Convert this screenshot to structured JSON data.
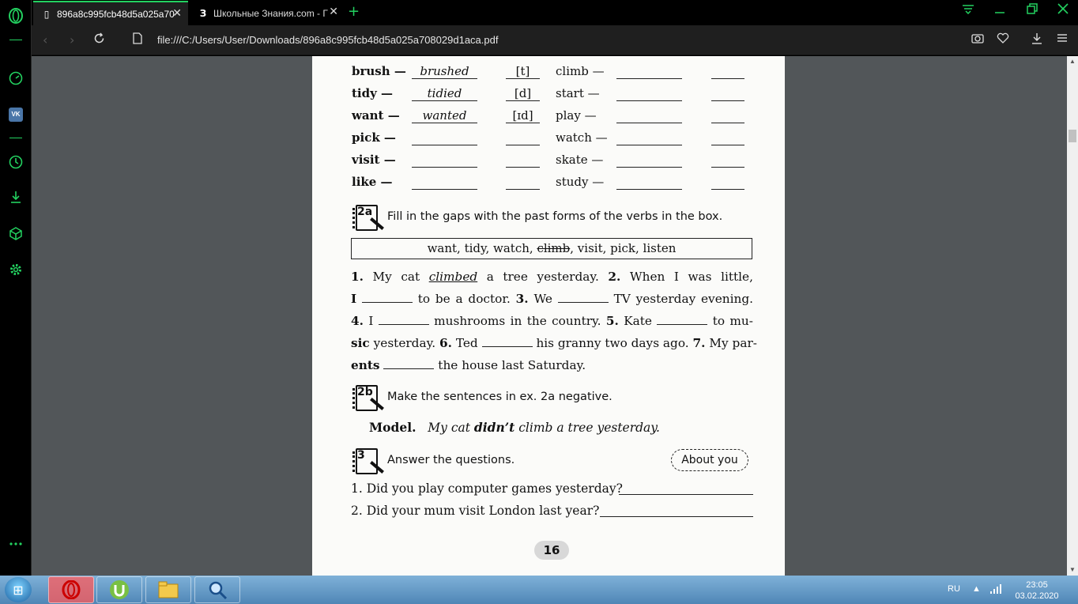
{
  "browser": {
    "tabs": [
      {
        "title": "896a8c995fcb48d5a025a70",
        "icon": "document-icon",
        "active": true
      },
      {
        "title": "Школьные Знания.com - Г",
        "icon": "znanija-icon",
        "active": false
      }
    ],
    "new_tab": "+",
    "close_glyph": "✕",
    "url": "file:///C:/Users/User/Downloads/896a8c995fcb48d5a025a708029d1aca.pdf",
    "accent_color": "#23d160"
  },
  "sidebar": {
    "icons": [
      "opera-logo-icon",
      "speed-dial-icon",
      "vk-icon",
      "history-icon",
      "downloads-icon",
      "extensions-icon",
      "settings-icon",
      "more-icon"
    ],
    "vk_label": "VK"
  },
  "pdf": {
    "verbs_left": [
      {
        "verb": "brush —",
        "past": "brushed",
        "sound": "[t]"
      },
      {
        "verb": "tidy —",
        "past": "tidied",
        "sound": "[d]"
      },
      {
        "verb": "want —",
        "past": "wanted",
        "sound": "[ɪd]"
      },
      {
        "verb": "pick —",
        "past": "",
        "sound": ""
      },
      {
        "verb": "visit —",
        "past": "",
        "sound": ""
      },
      {
        "verb": "like —",
        "past": "",
        "sound": ""
      }
    ],
    "verbs_right": [
      "climb —",
      "start —",
      "play —",
      "watch —",
      "skate —",
      "study —"
    ],
    "ex2a": {
      "num": "2a",
      "instruction": "Fill in the gaps with the past forms of the verbs in the box.",
      "box_before": "want, tidy, watch, ",
      "box_struck": "climb",
      "box_after": ", visit, pick, listen",
      "lines": [
        [
          "1.",
          "My",
          "cat",
          "climbed",
          "a",
          "tree",
          "yesterday.",
          "2.",
          "When",
          "I",
          "was",
          "little,"
        ],
        [
          "I",
          "_______",
          "to be a doctor.",
          "3.",
          "We",
          "_______",
          "TV yesterday evening."
        ],
        [
          "4.",
          "I",
          "_______",
          "mushrooms in the country.",
          "5.",
          "Kate",
          "_______",
          "to mu-"
        ],
        [
          "sic",
          "yesterday.",
          "6.",
          "Ted",
          "_______",
          "his granny two days ago.",
          "7.",
          "My par-"
        ],
        [
          "ents",
          "_______",
          "the house last Saturday."
        ]
      ]
    },
    "ex2b": {
      "num": "2b",
      "instruction": "Make the sentences in ex. 2a negative.",
      "model_label": "Model.",
      "model_before": "My cat ",
      "model_bold": "didn’t",
      "model_after": " climb a tree yesterday."
    },
    "ex3": {
      "num": "3",
      "instruction": "Answer the questions.",
      "badge": "About you",
      "q1": "1. Did you play computer games yesterday?",
      "q2": "2. Did your mum visit London last year?"
    },
    "page_number": "16"
  },
  "taskbar": {
    "apps": [
      "opera-icon",
      "utorrent-icon",
      "explorer-icon",
      "search-app-icon"
    ],
    "lang": "RU",
    "time": "23:05",
    "date": "03.02.2020"
  }
}
